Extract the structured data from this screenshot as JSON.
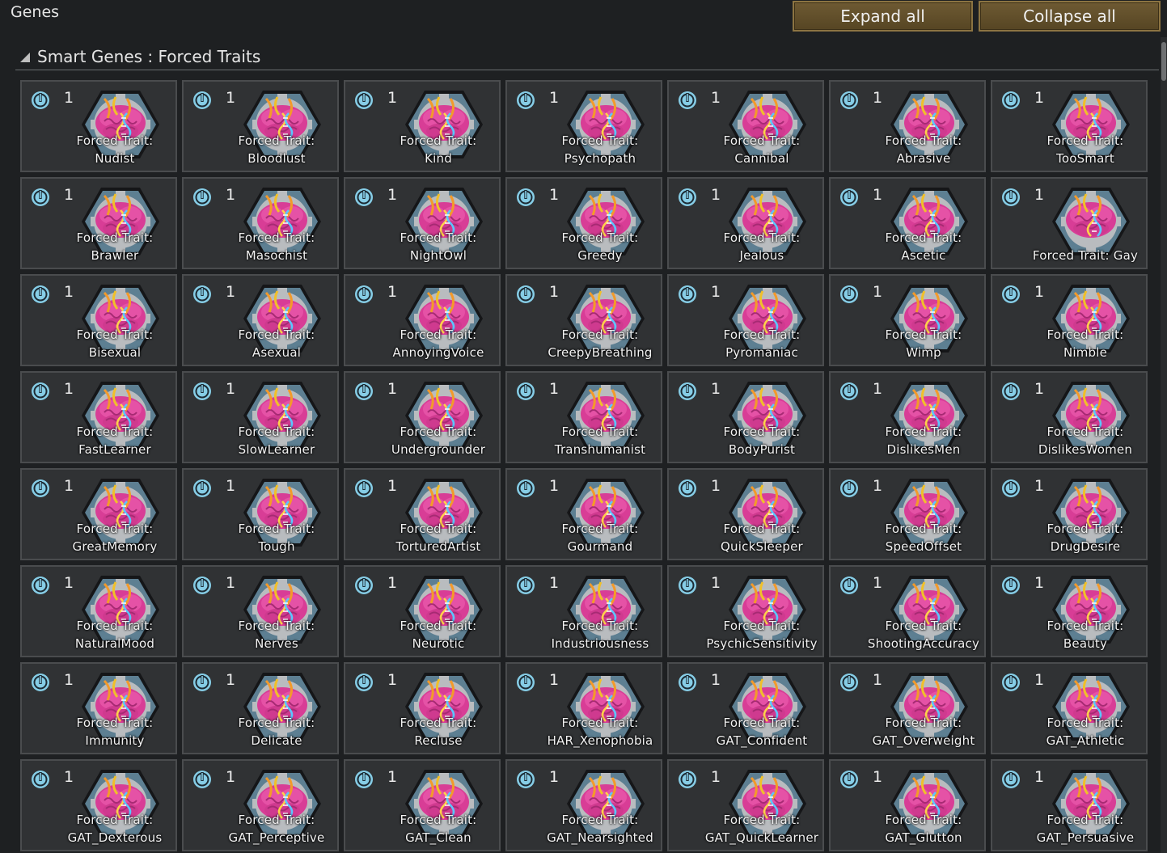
{
  "window": {
    "title": "Genes",
    "expand_label": "Expand all",
    "collapse_label": "Collapse all"
  },
  "section": {
    "label": "Smart Genes : Forced Traits"
  },
  "colors": {
    "background": "#1e2022",
    "card": "#303234",
    "card_border": "#4a4c4e",
    "button": "#5f4d29",
    "metabolism_icon": "#7ec8e3",
    "brain_pink": "#e0489a"
  },
  "icons": {
    "metabolism": "metabolism-efficiency-icon",
    "gene": "brain-gear-gene-icon"
  },
  "genes": [
    {
      "cost": "1",
      "prefix": "Forced Trait:",
      "name": "Nudist"
    },
    {
      "cost": "1",
      "prefix": "Forced Trait:",
      "name": "Bloodlust"
    },
    {
      "cost": "1",
      "prefix": "Forced Trait:",
      "name": "Kind"
    },
    {
      "cost": "1",
      "prefix": "Forced Trait:",
      "name": "Psychopath"
    },
    {
      "cost": "1",
      "prefix": "Forced Trait:",
      "name": "Cannibal"
    },
    {
      "cost": "1",
      "prefix": "Forced Trait:",
      "name": "Abrasive"
    },
    {
      "cost": "1",
      "prefix": "Forced Trait:",
      "name": "TooSmart"
    },
    {
      "cost": "1",
      "prefix": "Forced Trait:",
      "name": "Brawler"
    },
    {
      "cost": "1",
      "prefix": "Forced Trait:",
      "name": "Masochist"
    },
    {
      "cost": "1",
      "prefix": "Forced Trait:",
      "name": "NightOwl"
    },
    {
      "cost": "1",
      "prefix": "Forced Trait:",
      "name": "Greedy"
    },
    {
      "cost": "1",
      "prefix": "Forced Trait:",
      "name": "Jealous"
    },
    {
      "cost": "1",
      "prefix": "Forced Trait:",
      "name": "Ascetic"
    },
    {
      "cost": "1",
      "prefix": "",
      "name": "Forced Trait: Gay"
    },
    {
      "cost": "1",
      "prefix": "Forced Trait:",
      "name": "Bisexual"
    },
    {
      "cost": "1",
      "prefix": "Forced Trait:",
      "name": "Asexual"
    },
    {
      "cost": "1",
      "prefix": "Forced Trait:",
      "name": "AnnoyingVoice"
    },
    {
      "cost": "1",
      "prefix": "Forced Trait:",
      "name": "CreepyBreathing"
    },
    {
      "cost": "1",
      "prefix": "Forced Trait:",
      "name": "Pyromaniac"
    },
    {
      "cost": "1",
      "prefix": "Forced Trait:",
      "name": "Wimp"
    },
    {
      "cost": "1",
      "prefix": "Forced Trait:",
      "name": "Nimble"
    },
    {
      "cost": "1",
      "prefix": "Forced Trait:",
      "name": "FastLearner"
    },
    {
      "cost": "1",
      "prefix": "Forced Trait:",
      "name": "SlowLearner"
    },
    {
      "cost": "1",
      "prefix": "Forced Trait:",
      "name": "Undergrounder"
    },
    {
      "cost": "1",
      "prefix": "Forced Trait:",
      "name": "Transhumanist"
    },
    {
      "cost": "1",
      "prefix": "Forced Trait:",
      "name": "BodyPurist"
    },
    {
      "cost": "1",
      "prefix": "Forced Trait:",
      "name": "DislikesMen"
    },
    {
      "cost": "1",
      "prefix": "Forced Trait:",
      "name": "DislikesWomen"
    },
    {
      "cost": "1",
      "prefix": "Forced Trait:",
      "name": "GreatMemory"
    },
    {
      "cost": "1",
      "prefix": "Forced Trait:",
      "name": "Tough"
    },
    {
      "cost": "1",
      "prefix": "Forced Trait:",
      "name": "TorturedArtist"
    },
    {
      "cost": "1",
      "prefix": "Forced Trait:",
      "name": "Gourmand"
    },
    {
      "cost": "1",
      "prefix": "Forced Trait:",
      "name": "QuickSleeper"
    },
    {
      "cost": "1",
      "prefix": "Forced Trait:",
      "name": "SpeedOffset"
    },
    {
      "cost": "1",
      "prefix": "Forced Trait:",
      "name": "DrugDesire"
    },
    {
      "cost": "1",
      "prefix": "Forced Trait:",
      "name": "NaturalMood"
    },
    {
      "cost": "1",
      "prefix": "Forced Trait:",
      "name": "Nerves"
    },
    {
      "cost": "1",
      "prefix": "Forced Trait:",
      "name": "Neurotic"
    },
    {
      "cost": "1",
      "prefix": "Forced Trait:",
      "name": "Industriousness"
    },
    {
      "cost": "1",
      "prefix": "Forced Trait:",
      "name": "PsychicSensitivity"
    },
    {
      "cost": "1",
      "prefix": "Forced Trait:",
      "name": "ShootingAccuracy"
    },
    {
      "cost": "1",
      "prefix": "Forced Trait:",
      "name": "Beauty"
    },
    {
      "cost": "1",
      "prefix": "Forced Trait:",
      "name": "Immunity"
    },
    {
      "cost": "1",
      "prefix": "Forced Trait:",
      "name": "Delicate"
    },
    {
      "cost": "1",
      "prefix": "Forced Trait:",
      "name": "Recluse"
    },
    {
      "cost": "1",
      "prefix": "Forced Trait:",
      "name": "HAR_Xenophobia"
    },
    {
      "cost": "1",
      "prefix": "Forced Trait:",
      "name": "GAT_Confident"
    },
    {
      "cost": "1",
      "prefix": "Forced Trait:",
      "name": "GAT_Overweight"
    },
    {
      "cost": "1",
      "prefix": "Forced Trait:",
      "name": "GAT_Athletic"
    },
    {
      "cost": "1",
      "prefix": "Forced Trait:",
      "name": "GAT_Dexterous"
    },
    {
      "cost": "1",
      "prefix": "Forced Trait:",
      "name": "GAT_Perceptive"
    },
    {
      "cost": "1",
      "prefix": "Forced Trait:",
      "name": "GAT_Clean"
    },
    {
      "cost": "1",
      "prefix": "Forced Trait:",
      "name": "GAT_Nearsighted"
    },
    {
      "cost": "1",
      "prefix": "Forced Trait:",
      "name": "GAT_QuickLearner"
    },
    {
      "cost": "1",
      "prefix": "Forced Trait:",
      "name": "GAT_Glutton"
    },
    {
      "cost": "1",
      "prefix": "Forced Trait:",
      "name": "GAT_Persuasive"
    }
  ]
}
